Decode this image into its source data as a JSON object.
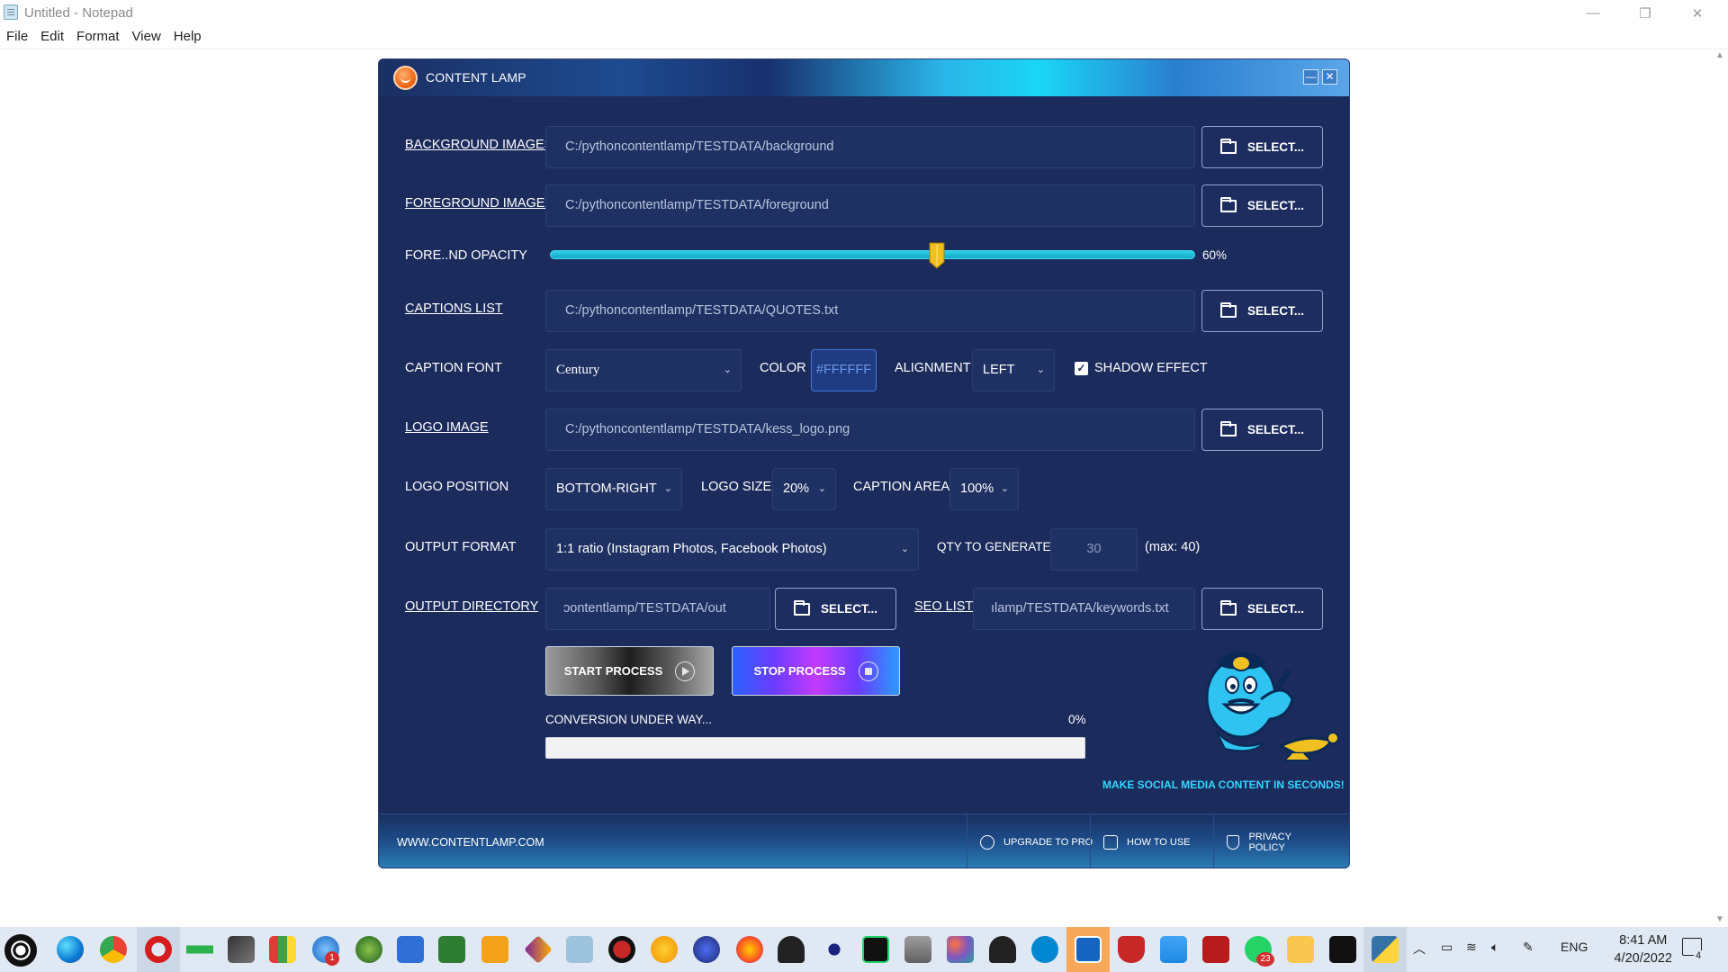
{
  "notepad": {
    "title": "Untitled - Notepad",
    "menu": [
      "File",
      "Edit",
      "Format",
      "View",
      "Help"
    ],
    "controls": {
      "minimize": "—",
      "maximize": "❐",
      "close": "✕"
    }
  },
  "app": {
    "title": "CONTENT LAMP",
    "window_buttons": {
      "minimize": "—",
      "close": "✕"
    },
    "background_images": {
      "label": "BACKGROUND IMAGES",
      "value": "C:/pythoncontentlamp/TESTDATA/background",
      "button": "SELECT..."
    },
    "foreground_images": {
      "label": "FOREGROUND IMAGES",
      "value": "C:/pythoncontentlamp/TESTDATA/foreground",
      "button": "SELECT..."
    },
    "opacity": {
      "label": "FORE..ND OPACITY",
      "value_text": "60%",
      "value": 0.6
    },
    "captions_list": {
      "label": "CAPTIONS LIST",
      "value": "C:/pythoncontentlamp/TESTDATA/QUOTES.txt",
      "button": "SELECT..."
    },
    "caption_font": {
      "label": "CAPTION FONT",
      "value": "Century",
      "color_label": "COLOR",
      "color_value": "#FFFFFF",
      "alignment_label": "ALIGNMENT",
      "alignment_value": "LEFT",
      "shadow_label": "SHADOW EFFECT",
      "shadow_checked": true
    },
    "logo_image": {
      "label": "LOGO IMAGE",
      "value": "C:/pythoncontentlamp/TESTDATA/kess_logo.png",
      "button": "SELECT..."
    },
    "logo_position": {
      "label": "LOGO POSITION",
      "value": "BOTTOM-RIGHT",
      "size_label": "LOGO SIZE",
      "size_value": "20%",
      "caption_area_label": "CAPTION AREA",
      "caption_area_value": "100%"
    },
    "output_format": {
      "label": "OUTPUT FORMAT",
      "value": "1:1 ratio (Instagram Photos, Facebook Photos)",
      "qty_label": "QTY TO GENERATE",
      "qty_value": "30",
      "max_text": "(max: 40)"
    },
    "output_directory": {
      "label": "OUTPUT DIRECTORY",
      "value": "ɔontentlamp/TESTDATA/out",
      "button": "SELECT...",
      "seo_label": "SEO LIST",
      "seo_value": "ılamp/TESTDATA/keywords.txt",
      "seo_button": "SELECT..."
    },
    "start_button": "START PROCESS",
    "stop_button": "STOP PROCESS",
    "progress": {
      "label": "CONVERSION UNDER WAY...",
      "percent_text": "0%",
      "value": 0
    },
    "tagline": "MAKE SOCIAL MEDIA CONTENT IN SECONDS!",
    "footer": {
      "url": "WWW.CONTENTLAMP.COM",
      "upgrade": "UPGRADE TO PRO",
      "how_to": "HOW TO USE",
      "privacy": "PRIVACY POLICY"
    }
  },
  "taskbar": {
    "language": "ENG",
    "time": "8:41 AM",
    "date": "4/20/2022",
    "badge_mail": "1",
    "badge_whatsapp": "23",
    "notification_count": "4"
  },
  "colors": {
    "accent": "#1b2b5c",
    "slider": "#2ad0e8",
    "thumb": "#f0c020",
    "tagline": "#35d6ff"
  }
}
